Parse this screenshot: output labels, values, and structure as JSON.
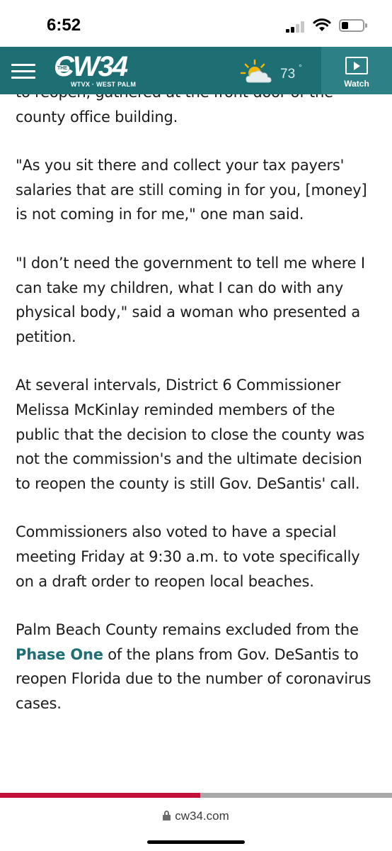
{
  "status_bar": {
    "time": "6:52"
  },
  "header": {
    "logo_small": "THE",
    "logo_brand": "CW34",
    "logo_sub": "WTVX · WEST PALM",
    "weather_temp": "73",
    "weather_degree": "°",
    "weather_icon": "partly-sunny-icon",
    "watch_label": "Watch",
    "accent_color": "#1e6f74"
  },
  "article": {
    "paragraphs": [
      {
        "text": "to reopen, gathered at the front door of the county office building."
      },
      {
        "text": "\"As you sit there and collect your tax payers' salaries that are still coming in for you, [money] is not coming in for me,\" one man said."
      },
      {
        "text": "\"I don’t need the government to tell me where I can take my children, what I can do with any physical body,\" said a woman who presented a petition."
      },
      {
        "text": "At several intervals, District 6 Commissioner Melissa McKinlay reminded members of the public that the decision to close the county was not the commission's and the ultimate decision to reopen the county is still Gov. DeSantis' call."
      },
      {
        "text": "Commissioners also voted to have a special meeting Friday at 9:30 a.m. to vote specifically on a draft order to reopen local beaches."
      },
      {
        "before": "Palm Beach County remains excluded from the ",
        "link": "Phase One",
        "after": " of the plans from Gov. DeSantis to reopen Florida due to the number of coronavirus cases."
      }
    ]
  },
  "reading_progress": 0.51,
  "browser": {
    "url": "cw34.com"
  }
}
